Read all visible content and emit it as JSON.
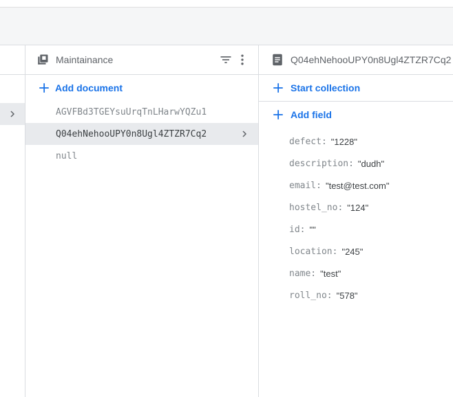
{
  "collection": {
    "title": "Maintainance",
    "add_document_label": "Add document",
    "documents": [
      {
        "id": "AGVFBd3TGEYsuUrqTnLHarwYQZu1",
        "selected": false
      },
      {
        "id": "Q04ehNehooUPY0n8Ugl4ZTZR7Cq2",
        "selected": true
      },
      {
        "id": "null",
        "selected": false
      }
    ]
  },
  "document": {
    "title": "Q04ehNehooUPY0n8Ugl4ZTZR7Cq2",
    "start_collection_label": "Start collection",
    "add_field_label": "Add field",
    "fields": [
      {
        "key": "defect:",
        "value": "\"1228\""
      },
      {
        "key": "description:",
        "value": "\"dudh\""
      },
      {
        "key": "email:",
        "value": "\"test@test.com\""
      },
      {
        "key": "hostel_no:",
        "value": "\"124\""
      },
      {
        "key": "id:",
        "value": "\"\""
      },
      {
        "key": "location:",
        "value": "\"245\""
      },
      {
        "key": "name:",
        "value": "\"test\""
      },
      {
        "key": "roll_no:",
        "value": "\"578\""
      }
    ]
  },
  "icons": {
    "collection": "collection-icon",
    "document": "document-icon",
    "filter": "filter-icon",
    "more": "more-vert-icon",
    "add": "plus-icon",
    "chevron": "chevron-right-icon"
  },
  "colors": {
    "accent": "#1a73e8",
    "selected_row": "#e8eaed",
    "muted_text": "#80868b",
    "border": "#dadce0"
  }
}
